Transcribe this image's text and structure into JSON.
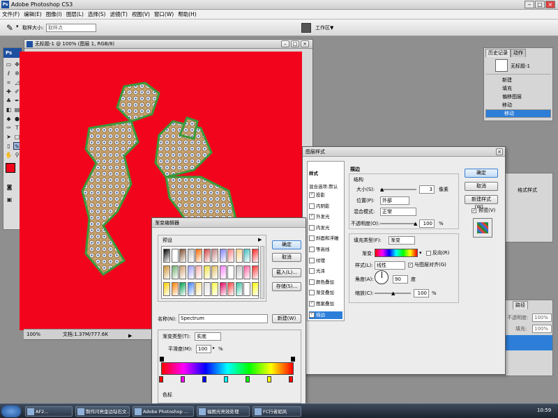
{
  "app": {
    "title": "Adobe Photoshop CS3",
    "logo_icon": "photoshop-logo-icon"
  },
  "menu": [
    "文件(F)",
    "编辑(E)",
    "图像(I)",
    "图层(L)",
    "选择(S)",
    "滤镜(T)",
    "视图(V)",
    "窗口(W)",
    "帮助(H)"
  ],
  "options_bar": {
    "sample_size_label": "取样大小:",
    "sample_size_value": "取样点",
    "workspace_label": "工作区▼"
  },
  "toolbox": {
    "header": "Ps"
  },
  "document": {
    "title": "无标题-1 @ 100% (图层 1, RGB/8)",
    "zoom": "100%",
    "doc_info": "文档:1.37M/777.6K",
    "canvas_color": "#f2051c"
  },
  "history_panel": {
    "tabs": [
      "历史记录",
      "动作"
    ],
    "snapshot": "无标题-1",
    "items": [
      "新建",
      "填充",
      "偏移图层",
      "移动",
      "移动"
    ],
    "selected_index": 4
  },
  "styles_panel": {
    "fragment": "格式样式",
    "new_style": "新建样式(W)...",
    "preview": "预览(V)"
  },
  "layers_panel": {
    "opacity_label": "不透明度:",
    "opacity_value": "100%",
    "fill_label": "填充:",
    "fill_value": "100%",
    "tab": "路径"
  },
  "layer_style_dialog": {
    "title": "图层样式",
    "styles_header": "样式",
    "blend_options": "混合选项:默认",
    "effects": [
      {
        "label": "投影",
        "checked": true
      },
      {
        "label": "内阴影",
        "checked": false
      },
      {
        "label": "外发光",
        "checked": true
      },
      {
        "label": "内发光",
        "checked": false
      },
      {
        "label": "斜面和浮雕",
        "checked": false
      },
      {
        "label": "等高线",
        "checked": false
      },
      {
        "label": "纹理",
        "checked": false
      },
      {
        "label": "光泽",
        "checked": false
      },
      {
        "label": "颜色叠加",
        "checked": false
      },
      {
        "label": "渐变叠加",
        "checked": false
      },
      {
        "label": "图案叠加",
        "checked": true
      },
      {
        "label": "描边",
        "checked": true
      }
    ],
    "selected_effect": "描边",
    "section_title": "描边",
    "structure_label": "结构",
    "size_label": "大小(S):",
    "size_value": "3",
    "size_unit": "像素",
    "position_label": "位置(P):",
    "position_value": "外部",
    "blend_mode_label": "混合模式:",
    "blend_mode_value": "正常",
    "opacity_label": "不透明度(O):",
    "opacity_value": "100",
    "percent": "%",
    "fill_type_label": "填充类型(F):",
    "fill_type_value": "渐变",
    "gradient_label": "渐变:",
    "reverse_label": "反向(R)",
    "style_label": "样式(L):",
    "style_value": "线性",
    "align_label": "与图层对齐(G)",
    "angle_label": "角度(A):",
    "angle_value": "90",
    "angle_unit": "度",
    "scale_label": "缩放(C):",
    "scale_value": "100",
    "ok": "确定",
    "cancel": "取消",
    "new_style": "新建样式(W)...",
    "preview": "预览(V)"
  },
  "gradient_editor": {
    "title": "渐变编辑器",
    "presets_label": "预设",
    "ok": "确定",
    "cancel": "取消",
    "load": "载入(L)...",
    "save": "存储(S)...",
    "name_label": "名称(N):",
    "name_value": "Spectrum",
    "new_button": "新建(W)",
    "gradient_type_label": "渐变类型(T):",
    "gradient_type_value": "实底",
    "smoothness_label": "平滑度(M):",
    "smoothness_value": "100",
    "percent": "%",
    "stops_label": "色标",
    "color_stops": [
      "#ff0000",
      "#ff00ff",
      "#0000ff",
      "#00ffff",
      "#00ff00",
      "#ffff00",
      "#ff0000"
    ],
    "presets": [
      "#000000",
      "#ffffff",
      "#7a4a2a",
      "#c0c0c0",
      "#ff6a00",
      "#d04040",
      "#c08080",
      "#8080ff",
      "#ff8080",
      "#ffd080",
      "#40c0c0",
      "#ff2020",
      "#d09030",
      "#70b070",
      "#d0a070",
      "#a0a0ff",
      "#ffb0b0",
      "#f0e040",
      "#e0c060",
      "#ff80ff",
      "#ffffff",
      "#c0c0c0",
      "#ff60a0",
      "#ff3030",
      "#ffd000",
      "#ff8000",
      "#00a050",
      "#4080ff",
      "#ffe080",
      "#e0e0e0",
      "#ffff40",
      "#e00060",
      "#ff4040",
      "#30c0a0",
      "#ffffff",
      "#ffff00"
    ]
  },
  "taskbar": {
    "items": [
      "AF2...",
      "制作闪亮金边钻石文...",
      "Adobe Photoshop ...",
      "福图光亮效处理",
      "FC行者如风"
    ],
    "clock": "10:59"
  },
  "colors": {
    "foreground": "#f2051c",
    "background": "#ffffff",
    "selection": "#2c7ed8"
  }
}
